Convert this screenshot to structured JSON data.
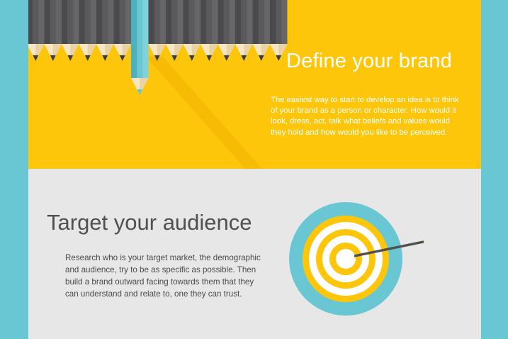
{
  "brand": {
    "title": "Define your brand",
    "text": "The easiest way to start to develop an idea is to think of your brand as a person or character. How would it look, dress, act, talk what beliefs and values would they hold and how would you like to be perceived."
  },
  "audience": {
    "title": "Target your audience",
    "text": "Research who is your target market, the demographic and audience, try to be as specific as possible. Then build a brand outward facing towards them that they can understand and relate to, one they can trust."
  },
  "colors": {
    "accent_teal": "#69c7d3",
    "brand_yellow": "#fec60b",
    "panel_grey": "#e7e7e8",
    "pencil_grey": "#5a5a5c",
    "target_teal": "#69c7d3",
    "arrow_orange": "#f59a1b"
  },
  "icons": {
    "pencils": "pencil-row-illustration",
    "highlighted_pencil": "teal-pencil-icon",
    "target": "bullseye-target-icon",
    "arrow": "arrow-icon"
  }
}
